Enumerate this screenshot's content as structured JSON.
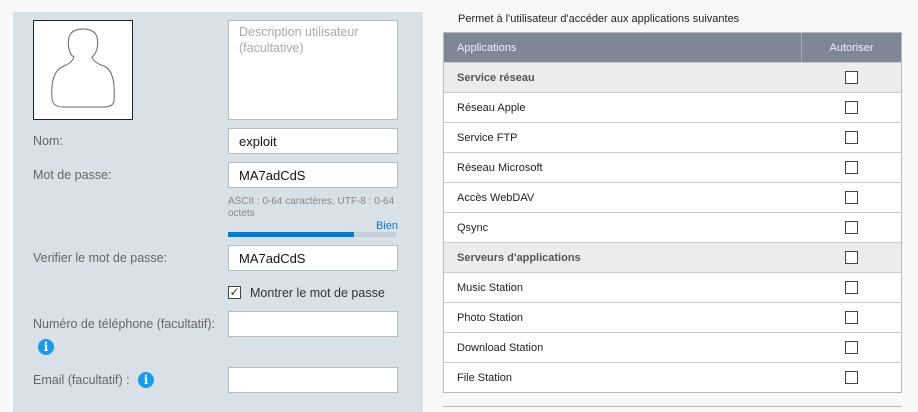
{
  "form": {
    "description_placeholder": "Description utilisateur (facultative)",
    "name_label": "Nom:",
    "name_value": "exploit",
    "password_label": "Mot de passe:",
    "password_value": "MA7adCdS",
    "password_hint": "ASCII : 0-64 caractères, UTF-8 : 0-64 octets",
    "strength_label": "Bien",
    "strength_percent": 75,
    "verify_label": "Verifier le mot de passe:",
    "verify_value": "MA7adCdS",
    "show_password_label": "Montrer le mot de passe",
    "show_password_checked": true,
    "phone_label": "Numéro de téléphone (facultatif):",
    "phone_value": "",
    "email_label": "Email (facultatif) :",
    "email_value": "",
    "colors": {
      "accent": "#0a7ac8",
      "info": "#1a9ae8",
      "panel": "#d9e1e8"
    }
  },
  "apps": {
    "title": "Permet à l'utilisateur d'accéder aux applications suivantes",
    "col_app": "Applications",
    "col_allow": "Autoriser",
    "rows": [
      {
        "label": "Service réseau",
        "group": true
      },
      {
        "label": "Réseau Apple"
      },
      {
        "label": "Service FTP"
      },
      {
        "label": "Réseau Microsoft"
      },
      {
        "label": "Accès WebDAV"
      },
      {
        "label": "Qsync"
      },
      {
        "label": "Serveurs d'applications",
        "group": true
      },
      {
        "label": "Music Station"
      },
      {
        "label": "Photo Station"
      },
      {
        "label": "Download Station"
      },
      {
        "label": "File Station"
      }
    ]
  }
}
